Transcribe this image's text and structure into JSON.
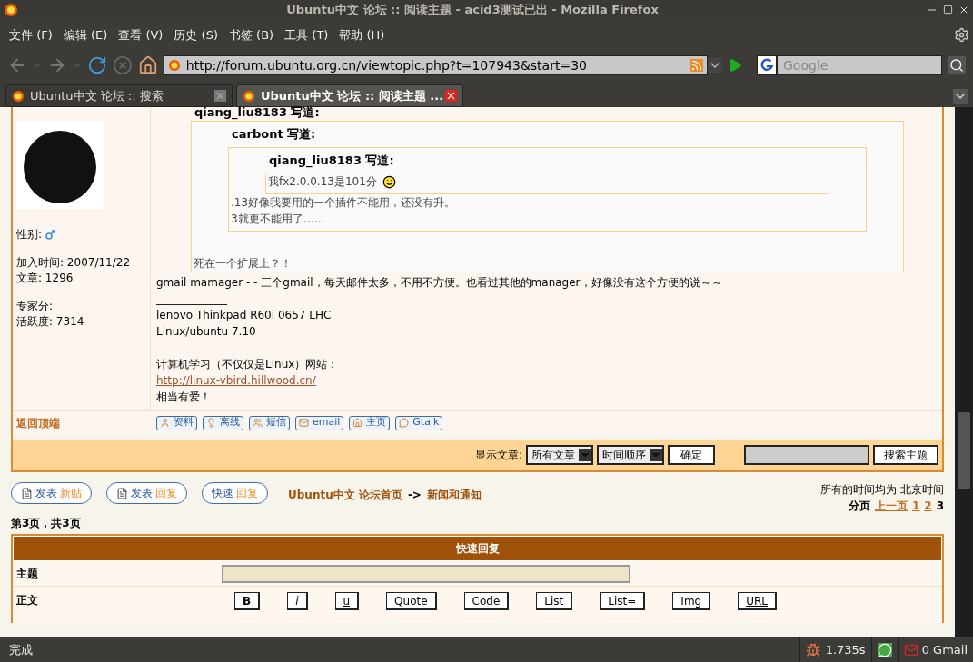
{
  "window": {
    "title": "Ubuntu中文 论坛 :: 阅读主题 - acid3测试已出 - Mozilla Firefox"
  },
  "menu": [
    "文件 (F)",
    "编辑 (E)",
    "查看 (V)",
    "历史 (S)",
    "书签 (B)",
    "工具 (T)",
    "帮助 (H)"
  ],
  "address_bar": {
    "value": "http://forum.ubuntu.org.cn/viewtopic.php?t=107943&start=30"
  },
  "search": {
    "placeholder": "Google"
  },
  "tabs": [
    {
      "label": "Ubuntu中文 论坛 :: 搜索",
      "selected": false
    },
    {
      "label": "Ubuntu中文 论坛 :: 阅读主题 ...",
      "selected": true
    }
  ],
  "post": {
    "author_info": [
      "性别:",
      "加入时间: 2007/11/22",
      "文章: 1296",
      "专家分:",
      "活跃度: 7314"
    ],
    "quote": {
      "author": "qiang_liu8183 写道:",
      "quote": {
        "author": "carbont 写道:",
        "quote": {
          "author": "qiang_liu8183 写道:",
          "lines": [
            "我fx2.0.0.13是101分"
          ]
        },
        "lines": [
          ".13好像我要用的一个插件不能用，还没有升。",
          "3就更不能用了……"
        ]
      },
      "lines": [
        "死在一个扩展上？！"
      ]
    },
    "body": "gmail mamager -  - 三个gmail，每天邮件太多，不用不方便。也看过其他的manager，好像没有这个方便的说～～",
    "signature_rule": "_____________",
    "signature": [
      "lenovo Thinkpad R60i 0657 LHC",
      "Linux/ubuntu 7.10"
    ],
    "signature_site": "计算机学习（不仅仅是Linux）网站：",
    "signature_link": "http://linux-vbird.hillwood.cn/",
    "signature_end": "相当有爱！",
    "back_to_top": "返回顶端",
    "profile_buttons": [
      "资料",
      "离线",
      "短信",
      "email",
      "主页",
      "Gtalk"
    ]
  },
  "filter_bar": {
    "label": "显示文章:",
    "selects": [
      "所有文章",
      "时间顺序"
    ],
    "confirm": "确定",
    "search_button": "搜索主题"
  },
  "action_buttons": [
    {
      "prefix": "发表",
      "accent": "新贴"
    },
    {
      "prefix": "发表",
      "accent": "回复"
    },
    {
      "prefix": "快速",
      "accent": "回复"
    }
  ],
  "breadcrumb": {
    "home": "Ubuntu中文 论坛首页",
    "separator": "->",
    "forum": "新闻和通知"
  },
  "timezone": "所有的时间均为 北京时间",
  "pagination": {
    "label": "分页",
    "previous": "上一页",
    "pages": [
      {
        "label": "1",
        "selected": false
      },
      {
        "label": "2",
        "selected": false
      },
      {
        "label": "3",
        "selected": true
      }
    ]
  },
  "page_info": "第3页，共3页",
  "quick_reply": {
    "title": "快速回复",
    "subject_label": "主题",
    "body_label": "正文",
    "format_buttons": [
      {
        "label": "B",
        "kind": "bold"
      },
      {
        "label": "i",
        "kind": "italic"
      },
      {
        "label": "u",
        "kind": "underline"
      },
      {
        "label": "Quote",
        "kind": "plain"
      },
      {
        "label": "Code",
        "kind": "plain"
      },
      {
        "label": "List",
        "kind": "plain"
      },
      {
        "label": "List=",
        "kind": "plain"
      },
      {
        "label": "Img",
        "kind": "plain"
      },
      {
        "label": "URL",
        "kind": "underline"
      }
    ]
  },
  "status_bar": {
    "text": "完成",
    "timer": "1.735s",
    "gmail": "0 Gmail"
  }
}
